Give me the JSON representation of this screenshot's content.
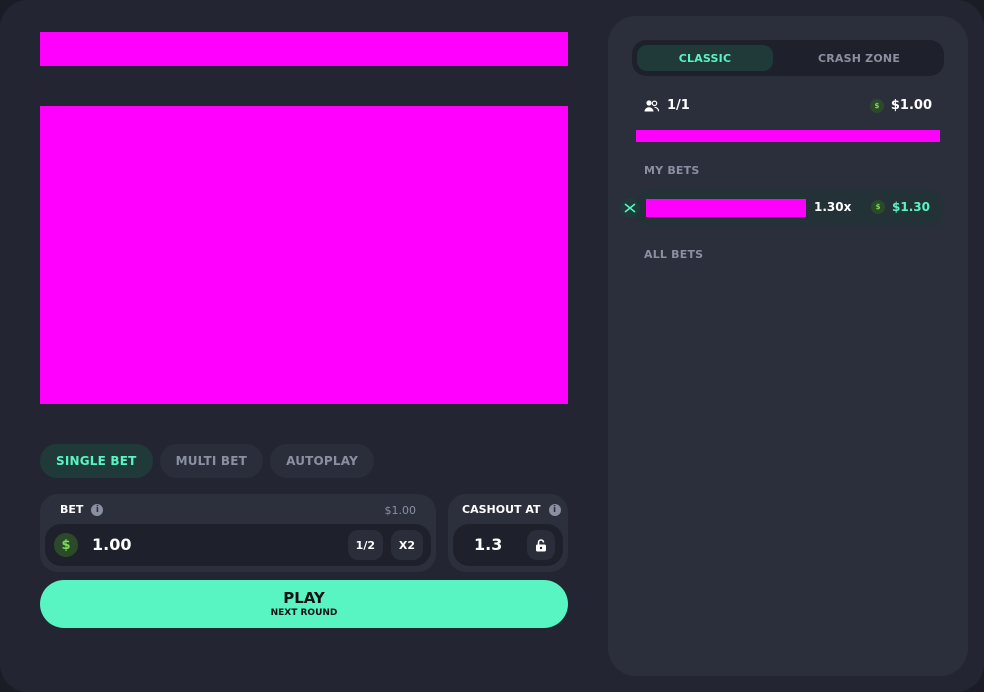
{
  "mode_tabs": {
    "single": "SINGLE BET",
    "multi": "MULTI BET",
    "auto": "AUTOPLAY"
  },
  "bet": {
    "label": "BET",
    "max": "$1.00",
    "currency_icon": "$",
    "value": "1.00",
    "half_label": "1/2",
    "double_label": "X2"
  },
  "cashout": {
    "label": "CASHOUT AT",
    "value": "1.3"
  },
  "play": {
    "label": "PLAY",
    "sublabel": "NEXT ROUND"
  },
  "sidebar": {
    "tabs": {
      "classic": "CLASSIC",
      "crash_zone": "CRASH ZONE"
    },
    "players": "1/1",
    "coin_symbol": "$",
    "pot": "$1.00",
    "progress_fraction": 1.0,
    "my_bets_title": "MY BETS",
    "all_bets_title": "ALL BETS",
    "my_bets": [
      {
        "multiplier": "1.30x",
        "win": "$1.30"
      }
    ]
  },
  "colors": {
    "accent": "#58f5c3",
    "background": "#232632",
    "panel": "#2b2f3c",
    "placeholder": "#ff00ff",
    "coin_green": "#7ddb5a"
  }
}
